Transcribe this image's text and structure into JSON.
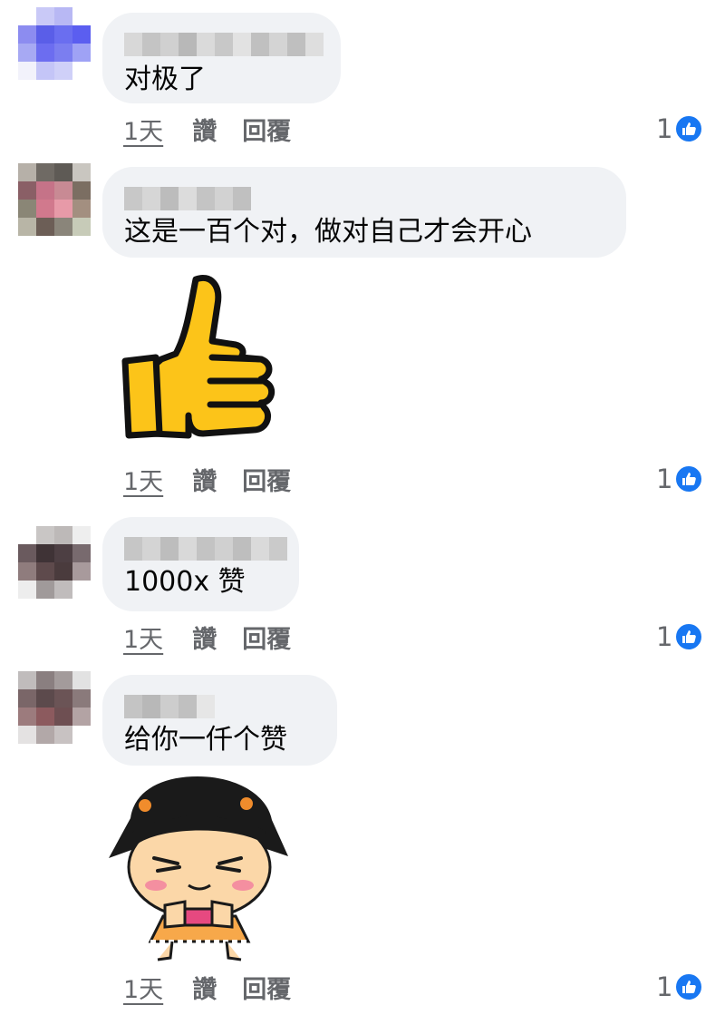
{
  "comments": [
    {
      "text": "对极了",
      "time": "1天",
      "like": "讚",
      "reply": "回覆",
      "reactions": "1"
    },
    {
      "text": "这是一百个对，做对自己才会开心",
      "time": "1天",
      "like": "讚",
      "reply": "回覆",
      "reactions": "1",
      "sticker": "thumbs-up-sticker"
    },
    {
      "text": "1000x 赞",
      "time": "1天",
      "like": "讚",
      "reply": "回覆",
      "reactions": "1"
    },
    {
      "text": "给你一仟个赞",
      "time": "1天",
      "like": "讚",
      "reply": "回覆",
      "reactions": "1",
      "sticker": "cartoon-girl-thumbs-up-sticker"
    }
  ],
  "colors": {
    "bubble": "#f0f2f5",
    "meta_text": "#65676b",
    "like_badge": "#1877f2",
    "sticker_yellow": "#fcc419"
  },
  "icons": {
    "reaction": "like-thumb-icon"
  }
}
